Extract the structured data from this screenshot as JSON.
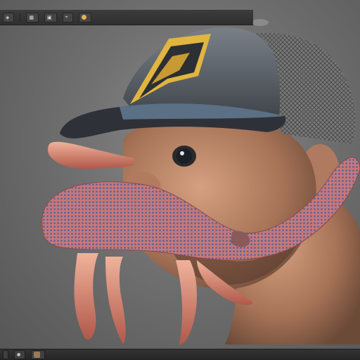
{
  "app": {
    "toolbar": {
      "items": [
        {
          "label": ""
        },
        {
          "label": ""
        },
        {
          "label": ""
        },
        {
          "label": ""
        },
        {
          "label": ""
        }
      ]
    },
    "status": {
      "items": [
        {
          "label": ""
        },
        {
          "label": ""
        },
        {
          "label": ""
        }
      ]
    },
    "icons": [
      "view-icon",
      "grid-icon",
      "light-icon",
      "camera-icon",
      "render-icon"
    ]
  },
  "colors": {
    "background": "#6f6f6f",
    "toolbar": "#333333",
    "cap_crown": "#4a5058",
    "cap_mesh": "#6a6a6a",
    "cap_logo": "#e0b640",
    "skin": "#b8866a",
    "tentacle": "#c86a6a",
    "tentacle_scales": "#5a5f8a"
  }
}
